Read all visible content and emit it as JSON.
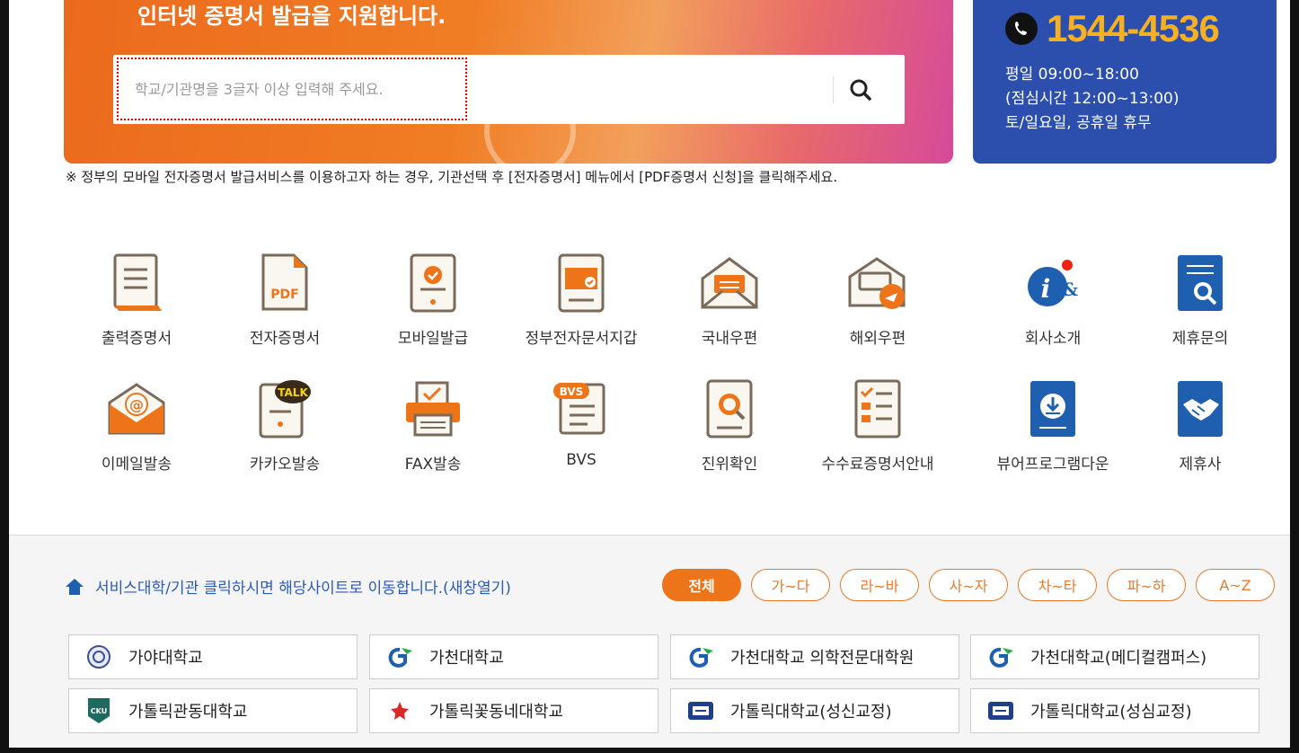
{
  "hero": {
    "title": "인터넷 증명서 발급을 지원합니다.",
    "search_placeholder": "학교/기관명을 3글자 이상 입력해 주세요.",
    "search_icon": "search-icon"
  },
  "call": {
    "number": "1544-4536",
    "hours_weekday": "평일 09:00~18:00",
    "hours_lunch": "(점심시간 12:00~13:00)",
    "hours_closed": "토/일요일, 공휴일 휴무"
  },
  "notice": "※ 정부의 모바일 전자증명서 발급서비스를 이용하고자 하는 경우, 기관선택 후 [전자증명서] 메뉴에서 [PDF증명서 신청]을 클릭해주세요.",
  "services": [
    {
      "label": "출력증명서",
      "icon": "print-certificate-icon"
    },
    {
      "label": "전자증명서",
      "icon": "pdf-document-icon"
    },
    {
      "label": "모바일발급",
      "icon": "mobile-issue-icon"
    },
    {
      "label": "정부전자문서지갑",
      "icon": "wallet-icon"
    },
    {
      "label": "국내우편",
      "icon": "domestic-mail-icon"
    },
    {
      "label": "해외우편",
      "icon": "overseas-mail-icon"
    },
    {
      "label": "회사소개",
      "icon": "company-info-icon"
    },
    {
      "label": "제휴문의",
      "icon": "partnership-inquiry-icon"
    },
    {
      "label": "이메일발송",
      "icon": "email-icon"
    },
    {
      "label": "카카오발송",
      "icon": "kakao-talk-icon"
    },
    {
      "label": "FAX발송",
      "icon": "fax-icon"
    },
    {
      "label": "BVS",
      "icon": "bvs-icon"
    },
    {
      "label": "진위확인",
      "icon": "verify-icon"
    },
    {
      "label": "수수료증명서안내",
      "icon": "fee-checklist-icon"
    },
    {
      "label": "뷰어프로그램다운",
      "icon": "viewer-download-icon"
    },
    {
      "label": "제휴사",
      "icon": "handshake-icon"
    }
  ],
  "lower": {
    "info_text": "서비스대학/기관 클릭하시면 해당사이트로 이동합니다.(새창열기)",
    "filters": [
      "전체",
      "가~다",
      "라~바",
      "사~자",
      "차~타",
      "파~하",
      "A~Z"
    ],
    "active_filter": "전체",
    "schools": [
      {
        "name": "가야대학교",
        "logo": "gaya-logo"
      },
      {
        "name": "가천대학교",
        "logo": "gachon-logo"
      },
      {
        "name": "가천대학교 의학전문대학원",
        "logo": "gachon-logo"
      },
      {
        "name": "가천대학교(메디컬캠퍼스)",
        "logo": "gachon-logo"
      },
      {
        "name": "가톨릭관동대학교",
        "logo": "cku-logo"
      },
      {
        "name": "가톨릭꽃동네대학교",
        "logo": "kkottongnae-logo"
      },
      {
        "name": "가톨릭대학교(성신교정)",
        "logo": "catholic-logo"
      },
      {
        "name": "가톨릭대학교(성심교정)",
        "logo": "catholic-logo"
      }
    ]
  },
  "colors": {
    "orange": "#ee7419",
    "blue": "#2c4fad",
    "link_blue": "#2a5ab5",
    "gold": "#f6b022"
  }
}
